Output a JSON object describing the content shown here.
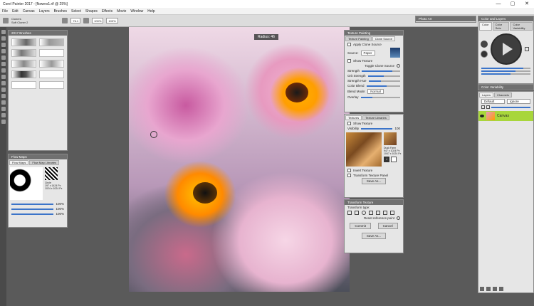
{
  "window": {
    "title": "Corel Painter 2017 - [flowers1.rif @ 25%]",
    "minimize": "—",
    "maximize": "▢",
    "close": "✕"
  },
  "menu": [
    "File",
    "Edit",
    "Canvas",
    "Layers",
    "Brushes",
    "Select",
    "Shapes",
    "Effects",
    "Movie",
    "Window",
    "Help"
  ],
  "propbar": {
    "brush_category": "Cloners",
    "brush_variant": "Soft Cloner 2",
    "size": "76.1",
    "opacity": "100%",
    "grain": "100%"
  },
  "brushes_panel": {
    "title": "2017 Brushes"
  },
  "flowmaps_panel": {
    "title": "Flow Maps",
    "tabs": [
      "Flow Maps",
      "Flow Map Libraries"
    ],
    "info": "Circle\n197 x 1424 Px\n1024 x 1024 Px",
    "values": [
      "100%",
      "100%",
      "100%"
    ]
  },
  "canvas": {
    "radius_label": "Radius: 46"
  },
  "palette_art": {
    "title": "Photo Art"
  },
  "texture_painting": {
    "title": "Texture Painting",
    "tabs": [
      "Texture Painting",
      "Clone Source"
    ],
    "apply_label": "Apply Clone Source",
    "source_label": "Source:",
    "source_value": "Paper",
    "show_texture": "Show Texture",
    "toggle": "Toggle Clone Source",
    "sliders": [
      "Strength",
      "Grit Strength",
      "Strength Hue",
      "Color Blend"
    ],
    "blend_label": "Blend Mode:",
    "blend_value": "Normal",
    "overlay": "Overlay"
  },
  "textures_panel": {
    "tabs": [
      "Textures",
      "Texture Libraries"
    ],
    "show_texture": "Show Texture",
    "visibility": "Visibility",
    "value": "100",
    "thumb_name": "Dusk Farm\n947 x 1024 Px\n1047 x 1024 Px",
    "invert": "Invert Texture",
    "transform": "Transform Texture Panel",
    "save_as": "Save As..."
  },
  "transform_panel": {
    "title": "Transform Texture",
    "transform_label": "Transform type:",
    "preserve": "Reset reference point",
    "commit": "Commit",
    "cancel": "Cancel",
    "save_as": "Save As..."
  },
  "color_panel": {
    "title": "Color and Layers",
    "tabs": [
      "Color",
      "Color Sets",
      "Color Variability"
    ]
  },
  "color_variability": {
    "title": "Color Variability"
  },
  "layers_panel": {
    "tabs": [
      "Layers",
      "Channels"
    ],
    "mode": "Default",
    "composite": "Ignore",
    "canvas_label": "Canvas"
  },
  "colors": {
    "accent": "#a8d63b",
    "slider": "#3b74c9"
  }
}
